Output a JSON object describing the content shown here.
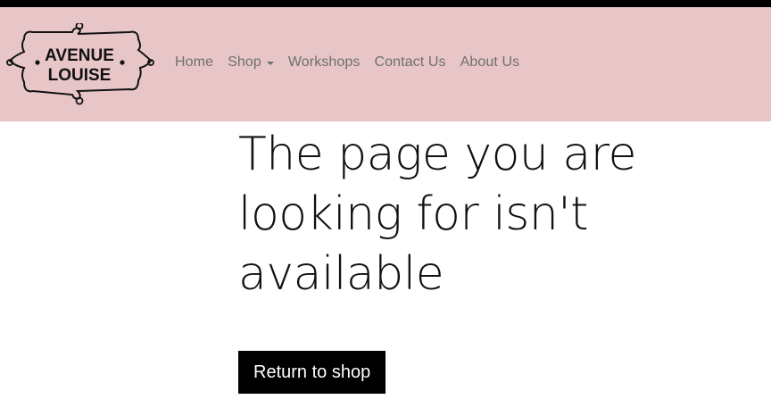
{
  "brand": {
    "logo_line1": "AVENUE",
    "logo_line2": "LOUISE"
  },
  "nav": {
    "items": [
      {
        "label": "Home"
      },
      {
        "label": "Shop",
        "has_dropdown": true
      },
      {
        "label": "Workshops"
      },
      {
        "label": "Contact Us"
      },
      {
        "label": "About Us"
      }
    ]
  },
  "main": {
    "title": "The page you are looking for isn't available",
    "button_label": "Return to shop"
  },
  "colors": {
    "header_bg": "#e8c6c8",
    "top_strip": "#000000",
    "nav_text": "#6f6f6f",
    "button_bg": "#000000",
    "button_text": "#ffffff"
  },
  "icons": {
    "dropdown": "chevron-down-icon",
    "logo_frame": "ornamental-frame-icon"
  }
}
